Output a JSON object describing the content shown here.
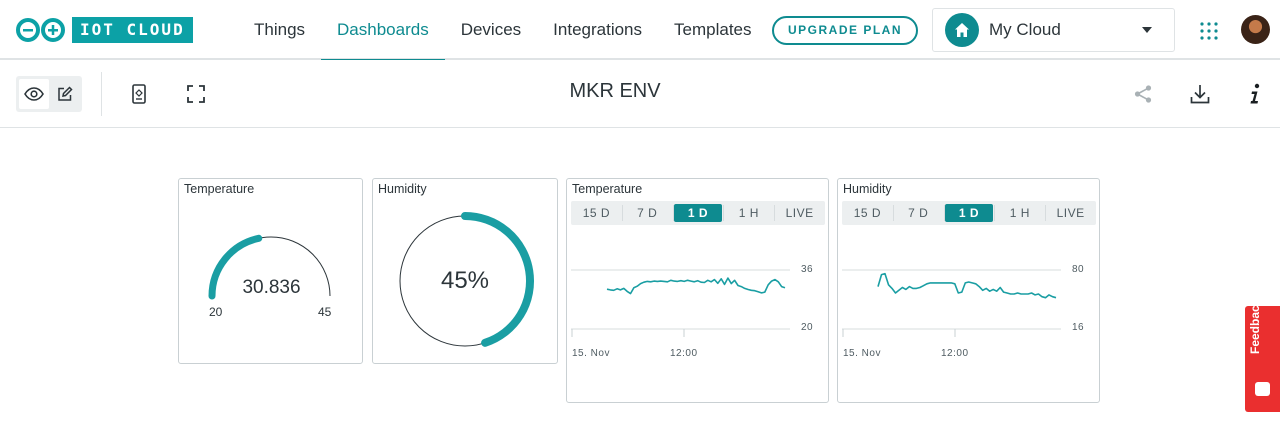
{
  "app": {
    "logo_text": "IOT CLOUD",
    "nav": [
      {
        "label": "Things",
        "active": false
      },
      {
        "label": "Dashboards",
        "active": true
      },
      {
        "label": "Devices",
        "active": false
      },
      {
        "label": "Integrations",
        "active": false
      },
      {
        "label": "Templates",
        "active": false
      }
    ],
    "upgrade_label": "UPGRADE PLAN",
    "space": {
      "name": "My Cloud",
      "icon": "home-icon"
    },
    "icons": {
      "apps": "apps-grid-icon",
      "avatar": "user-avatar"
    }
  },
  "toolbar": {
    "title": "MKR ENV",
    "icons": [
      "eye-icon",
      "edit-icon",
      "mobile-icon",
      "fullscreen-icon",
      "share-icon",
      "download-icon",
      "info-icon"
    ]
  },
  "widgets": {
    "temp_gauge": {
      "title": "Temperature",
      "value": "30.836",
      "min": "20",
      "max": "45"
    },
    "humidity_gauge": {
      "title": "Humidity",
      "value": "45%",
      "percent": 45
    },
    "temp_chart": {
      "title": "Temperature",
      "ranges": [
        "15 D",
        "7 D",
        "1 D",
        "1 H",
        "LIVE"
      ],
      "active_range": "1 D",
      "y_ticks": [
        "36",
        "20"
      ],
      "x_ticks": [
        "15. Nov",
        "12:00"
      ]
    },
    "humidity_chart": {
      "title": "Humidity",
      "ranges": [
        "15 D",
        "7 D",
        "1 D",
        "1 H",
        "LIVE"
      ],
      "active_range": "1 D",
      "y_ticks": [
        "80",
        "16"
      ],
      "x_ticks": [
        "15. Nov",
        "12:00"
      ]
    }
  },
  "chart_data": [
    {
      "type": "line",
      "title": "Temperature",
      "ylim": [
        20,
        36
      ],
      "x_ticks": [
        "15. Nov",
        "12:00"
      ],
      "series": [
        {
          "values": [
            30.8,
            30.6,
            30.5,
            30.9,
            30.6,
            31.0,
            30.2,
            29.6,
            31.2,
            31.6,
            32.3,
            32.7,
            32.9,
            32.8,
            33.0,
            32.9,
            33.0,
            32.9,
            32.8,
            33.2,
            33.0,
            32.9,
            33.1,
            32.9,
            33.2,
            33.0,
            32.8,
            33.1,
            32.7,
            32.6,
            33.2,
            32.8,
            33.4,
            32.4,
            33.6,
            32.1,
            33.8,
            32.3,
            33.2,
            31.8,
            31.5,
            31.0,
            30.7,
            30.5,
            30.4,
            30.1,
            29.8,
            30.0,
            32.0,
            33.0,
            33.4,
            32.8,
            31.5,
            31.2
          ]
        }
      ],
      "color": "#1a9ea3"
    },
    {
      "type": "line",
      "title": "Humidity",
      "ylim": [
        16,
        80
      ],
      "x_ticks": [
        "15. Nov",
        "12:00"
      ],
      "series": [
        {
          "values": [
            62,
            75,
            76,
            64,
            60,
            55,
            58,
            61,
            59,
            62,
            60,
            60,
            61,
            63,
            65,
            66,
            66,
            66,
            66,
            66,
            66,
            66,
            65,
            55,
            56,
            66,
            67,
            66,
            65,
            62,
            58,
            60,
            57,
            59,
            57,
            61,
            56,
            55,
            54,
            54,
            55,
            54,
            54,
            54,
            55,
            53,
            54,
            51,
            50,
            53,
            51,
            50
          ]
        }
      ],
      "color": "#1a9ea3"
    }
  ]
}
